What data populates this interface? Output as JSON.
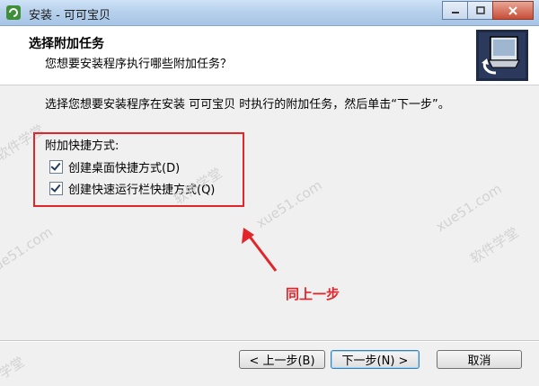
{
  "window": {
    "title": "安装 - 可可宝贝"
  },
  "header": {
    "title": "选择附加任务",
    "subtitle": "您想要安装程序执行哪些附加任务？"
  },
  "main": {
    "description": "选择您想要安装程序在安装 可可宝贝 时执行的附加任务，然后单击“下一步”。",
    "group_label": "附加快捷方式:",
    "options": [
      {
        "label": "创建桌面快捷方式(D)",
        "checked": true
      },
      {
        "label": "创建快速运行栏快捷方式(Q)",
        "checked": true
      }
    ]
  },
  "annotation": {
    "text": "同上一步",
    "color": "#e1252b"
  },
  "watermark": {
    "brand": "软件学堂",
    "domain": "xue51.com"
  },
  "buttons": {
    "back": "< 上一步(B)",
    "next": "下一步(N) >",
    "cancel": "取消"
  }
}
